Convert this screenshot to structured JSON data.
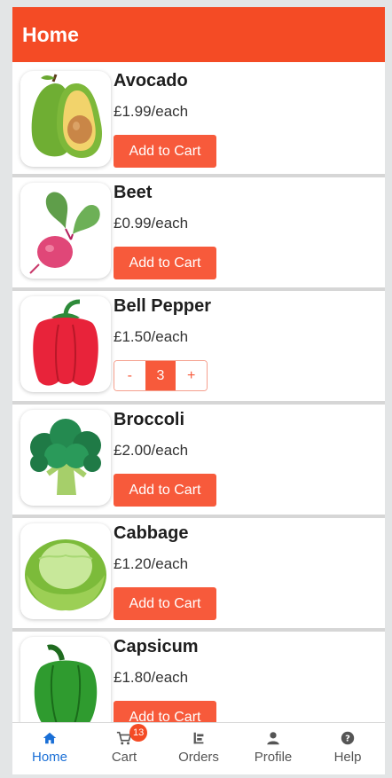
{
  "header": {
    "title": "Home"
  },
  "products": [
    {
      "name": "Avocado",
      "price": "£1.99/each",
      "button_label": "Add to Cart",
      "icon": "avocado-icon"
    },
    {
      "name": "Beet",
      "price": "£0.99/each",
      "button_label": "Add to Cart",
      "icon": "beet-icon"
    },
    {
      "name": "Bell Pepper",
      "price": "£1.50/each",
      "stepper": {
        "minus": "-",
        "quantity": "3",
        "plus": "+"
      },
      "icon": "bell-pepper-icon"
    },
    {
      "name": "Broccoli",
      "price": "£2.00/each",
      "button_label": "Add to Cart",
      "icon": "broccoli-icon"
    },
    {
      "name": "Cabbage",
      "price": "£1.20/each",
      "button_label": "Add to Cart",
      "icon": "cabbage-icon"
    },
    {
      "name": "Capsicum",
      "price": "£1.80/each",
      "button_label": "Add to Cart",
      "icon": "capsicum-icon"
    }
  ],
  "nav": {
    "items": [
      {
        "label": "Home",
        "icon": "home-icon",
        "active": true
      },
      {
        "label": "Cart",
        "icon": "cart-icon",
        "badge": "13"
      },
      {
        "label": "Orders",
        "icon": "orders-icon"
      },
      {
        "label": "Profile",
        "icon": "profile-icon"
      },
      {
        "label": "Help",
        "icon": "help-icon"
      }
    ]
  },
  "colors": {
    "accent": "#f44b25",
    "button": "#f75a3b",
    "nav_active": "#1a6fd6"
  }
}
